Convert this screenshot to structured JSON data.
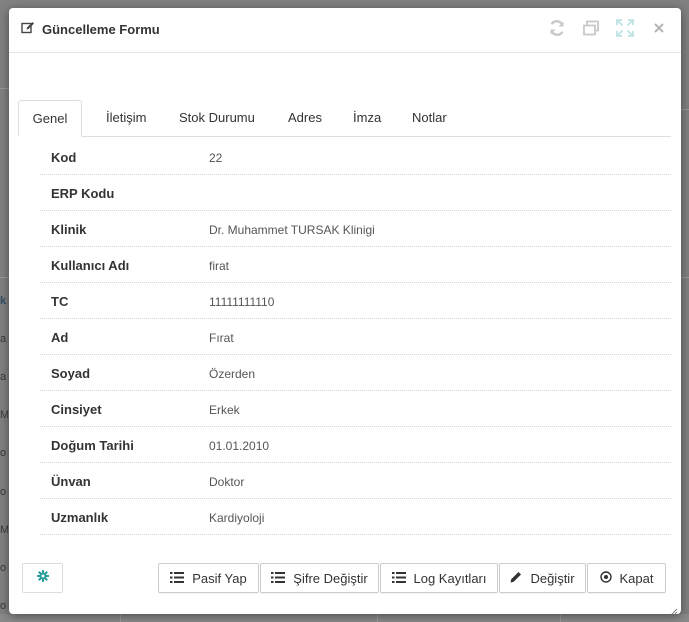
{
  "modal": {
    "title": "Güncelleme Formu"
  },
  "tabs": [
    {
      "label": "Genel"
    },
    {
      "label": "İletişim"
    },
    {
      "label": "Stok Durumu"
    },
    {
      "label": "Adres"
    },
    {
      "label": "İmza"
    },
    {
      "label": "Notlar"
    }
  ],
  "details": [
    {
      "label": "Kod",
      "value": "22"
    },
    {
      "label": "ERP Kodu",
      "value": ""
    },
    {
      "label": "Klinik",
      "value": "Dr. Muhammet TURSAK Klinigi"
    },
    {
      "label": "Kullanıcı Adı",
      "value": "firat"
    },
    {
      "label": "TC",
      "value": "11111111110"
    },
    {
      "label": "Ad",
      "value": "Fırat"
    },
    {
      "label": "Soyad",
      "value": "Özerden"
    },
    {
      "label": "Cinsiyet",
      "value": "Erkek"
    },
    {
      "label": "Doğum Tarihi",
      "value": "01.01.2010"
    },
    {
      "label": "Ünvan",
      "value": "Doktor"
    },
    {
      "label": "Uzmanlık",
      "value": "Kardiyoloji"
    }
  ],
  "footer": {
    "pasif_label": "Pasif Yap",
    "sifre_label": "Şifre Değiştir",
    "log_label": "Log Kayıtları",
    "degistir_label": "Değiştir",
    "kapat_label": "Kapat"
  },
  "colors": {
    "accent": "#2a9d9d",
    "header_icon": "#c9c9c9",
    "fullscreen_icon": "#bfe3e3"
  },
  "icons": {
    "title": "edit-icon",
    "refresh": "refresh-icon",
    "restore": "restore-icon",
    "fullscreen": "fullscreen-icon",
    "close": "close-icon",
    "settings": "gear-icon",
    "list": "list-icon",
    "pencil": "pencil-icon",
    "kapat": "circle-close-icon"
  }
}
